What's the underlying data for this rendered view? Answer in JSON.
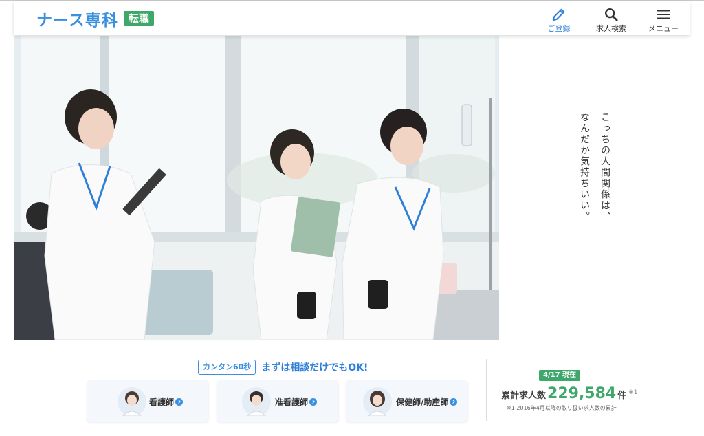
{
  "header": {
    "logo_text": "ナース専科",
    "logo_badge": "転職",
    "nav": [
      {
        "label": "ご登録",
        "icon": "pencil-icon"
      },
      {
        "label": "求人検索",
        "icon": "search-icon"
      },
      {
        "label": "メニュー",
        "icon": "hamburger-menu-icon"
      }
    ]
  },
  "hero": {
    "tagline_line1": "こっちの人間関係は、",
    "tagline_line2": "なんだか気持ちいい。"
  },
  "cta": {
    "badge": "カンタン60秒",
    "title": "まずは相談だけでもOK!",
    "cards": [
      {
        "label": "看護師"
      },
      {
        "label": "准看護師"
      },
      {
        "label": "保健師/助産師"
      }
    ]
  },
  "stats": {
    "date_badge": "4/17 現在",
    "label": "累計求人数",
    "value": "229,584",
    "unit": "件",
    "mark": "※1",
    "note": "※1 2016年4月以降の取り扱い求人数の累計"
  },
  "colors": {
    "brand_blue": "#3a8fe0",
    "brand_green": "#3ea86a"
  }
}
